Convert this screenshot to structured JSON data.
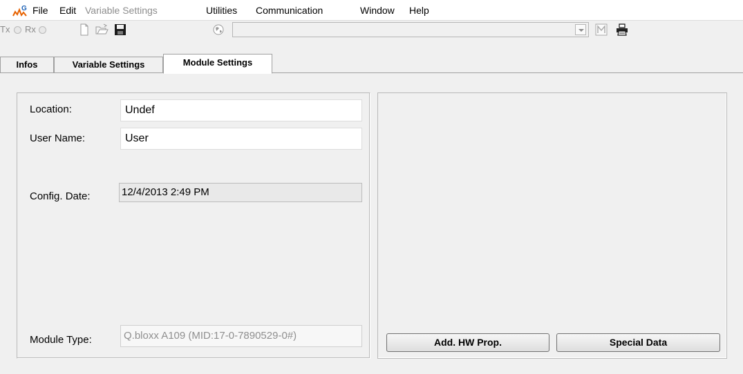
{
  "menubar": {
    "items": [
      {
        "label": "File",
        "enabled": true
      },
      {
        "label": "Edit",
        "enabled": true
      },
      {
        "label": "Variable Settings",
        "enabled": false
      },
      {
        "label": "Utilities",
        "enabled": true
      },
      {
        "label": "Communication",
        "enabled": true
      },
      {
        "label": "Window",
        "enabled": true
      },
      {
        "label": "Help",
        "enabled": true
      }
    ]
  },
  "toolbar": {
    "tx_label": "Tx",
    "rx_label": "Rx",
    "icons": [
      "new-document-icon",
      "open-folder-icon",
      "save-disk-icon",
      "globe-icon",
      "m-icon",
      "printer-icon"
    ],
    "combo_value": ""
  },
  "tabs": [
    {
      "label": "Infos",
      "active": false
    },
    {
      "label": "Variable Settings",
      "active": false
    },
    {
      "label": "Module Settings",
      "active": true
    }
  ],
  "module": {
    "location_label": "Location:",
    "location_value": "Undef",
    "user_name_label": "User Name:",
    "user_name_value": "User",
    "config_date_label": "Config. Date:",
    "config_date_value": "12/4/2013 2:49 PM",
    "module_type_label": "Module Type:",
    "module_type_value": "Q.bloxx A109 (MID:17-0-7890529-0#)"
  },
  "buttons": {
    "add_hw_prop": "Add. HW Prop.",
    "special_data": "Special Data"
  },
  "colors": {
    "window_bg": "#f0f0f0",
    "disabled_text": "#8d8d8d",
    "border": "#a0a0a0"
  }
}
